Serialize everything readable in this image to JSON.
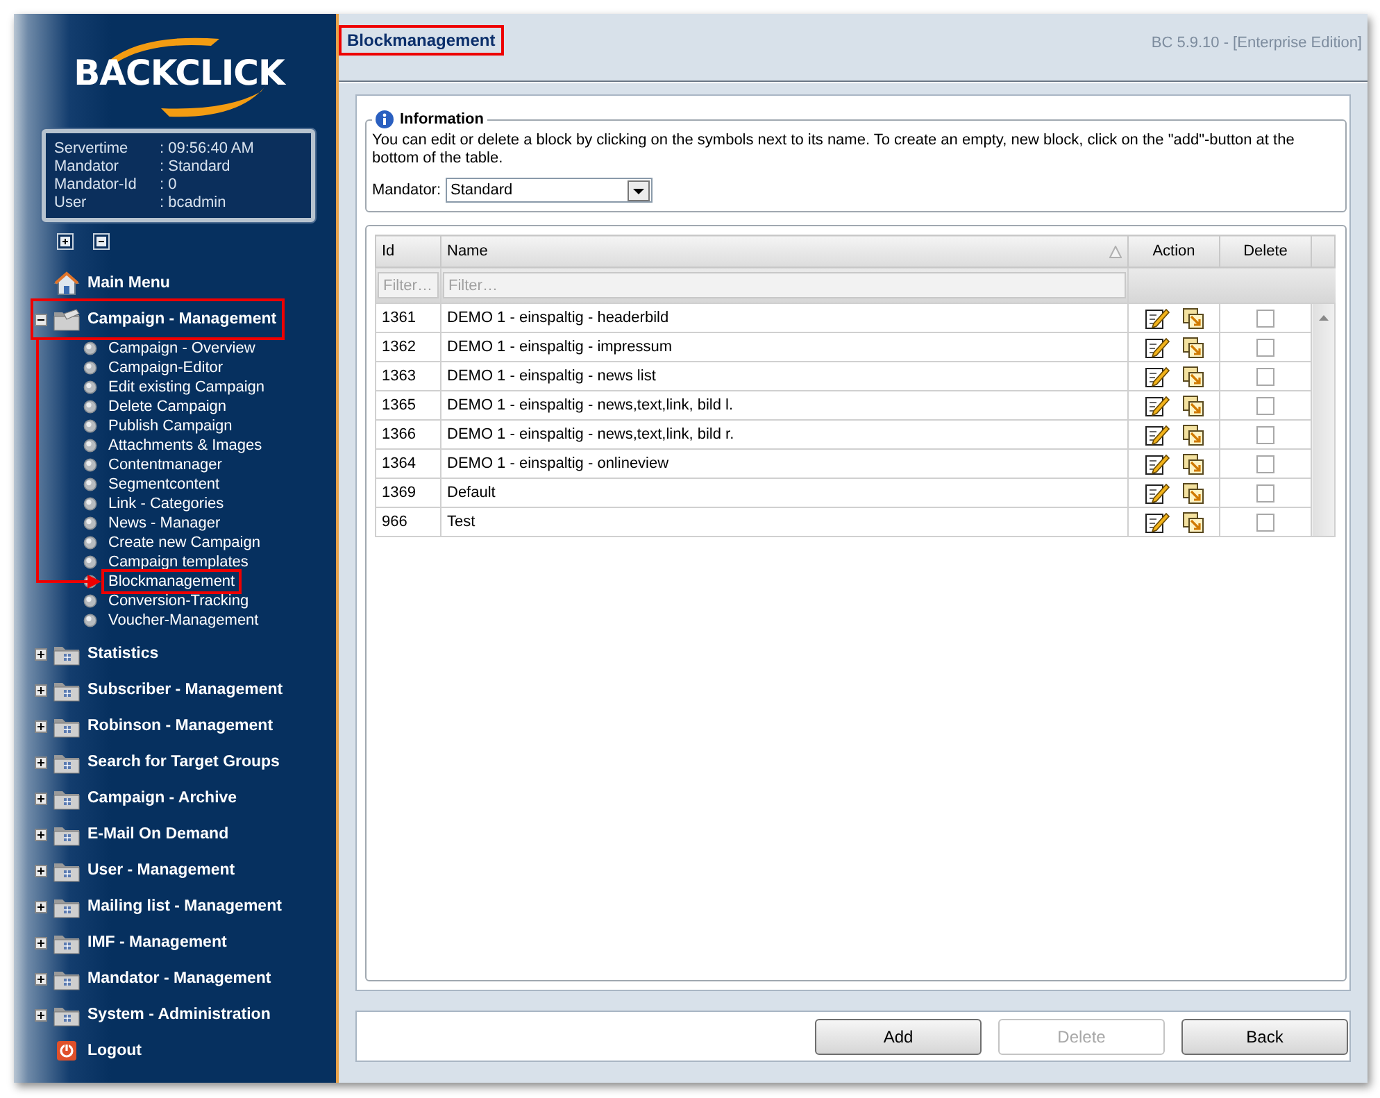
{
  "logo": {
    "text": "BACKCLICK"
  },
  "session": [
    {
      "label": "Servertime",
      "value": ": 09:56:40 AM"
    },
    {
      "label": "Mandator",
      "value": ": Standard"
    },
    {
      "label": "Mandator-Id",
      "value": ": 0"
    },
    {
      "label": "User",
      "value": ": bcadmin"
    }
  ],
  "menu": [
    {
      "kind": "home",
      "label": "Main Menu",
      "highlighted": false
    },
    {
      "kind": "folder",
      "label": "Campaign - Management",
      "expanded": true,
      "highlighted": true,
      "children": [
        {
          "label": "Campaign - Overview",
          "highlighted": false
        },
        {
          "label": "Campaign-Editor",
          "highlighted": false
        },
        {
          "label": "Edit existing Campaign",
          "highlighted": false
        },
        {
          "label": "Delete Campaign",
          "highlighted": false
        },
        {
          "label": "Publish Campaign",
          "highlighted": false
        },
        {
          "label": "Attachments & Images",
          "highlighted": false
        },
        {
          "label": "Contentmanager",
          "highlighted": false
        },
        {
          "label": "Segmentcontent",
          "highlighted": false
        },
        {
          "label": "Link - Categories",
          "highlighted": false
        },
        {
          "label": "News - Manager",
          "highlighted": false
        },
        {
          "label": "Create new Campaign",
          "highlighted": false
        },
        {
          "label": "Campaign templates",
          "highlighted": false
        },
        {
          "label": "Blockmanagement",
          "highlighted": true
        },
        {
          "label": "Conversion-Tracking",
          "highlighted": false
        },
        {
          "label": "Voucher-Management",
          "highlighted": false
        }
      ]
    },
    {
      "kind": "folder",
      "label": "Statistics",
      "expanded": false,
      "highlighted": false
    },
    {
      "kind": "folder",
      "label": "Subscriber - Management",
      "expanded": false,
      "highlighted": false
    },
    {
      "kind": "folder",
      "label": "Robinson - Management",
      "expanded": false,
      "highlighted": false
    },
    {
      "kind": "folder",
      "label": "Search for Target Groups",
      "expanded": false,
      "highlighted": false
    },
    {
      "kind": "folder",
      "label": "Campaign - Archive",
      "expanded": false,
      "highlighted": false
    },
    {
      "kind": "folder",
      "label": "E-Mail On Demand",
      "expanded": false,
      "highlighted": false
    },
    {
      "kind": "folder",
      "label": "User - Management",
      "expanded": false,
      "highlighted": false
    },
    {
      "kind": "folder",
      "label": "Mailing list - Management",
      "expanded": false,
      "highlighted": false
    },
    {
      "kind": "folder",
      "label": "IMF - Management",
      "expanded": false,
      "highlighted": false
    },
    {
      "kind": "folder",
      "label": "Mandator - Management",
      "expanded": false,
      "highlighted": false
    },
    {
      "kind": "folder",
      "label": "System - Administration",
      "expanded": false,
      "highlighted": false
    },
    {
      "kind": "logout",
      "label": "Logout",
      "highlighted": false
    }
  ],
  "header": {
    "title": "Blockmanagement",
    "highlighted": true,
    "version": "BC 5.9.10 - [Enterprise Edition]"
  },
  "information": {
    "legend": "Information",
    "text": "You can edit or delete a block by clicking on the symbols next to its name. To create an empty, new block, click on the \"add\"-button at the bottom of the table.",
    "mandator_label": "Mandator:",
    "mandator_value": "Standard"
  },
  "table": {
    "columns": [
      {
        "label": "Id",
        "sorted": false
      },
      {
        "label": "Name",
        "sorted": true
      },
      {
        "label": "Action",
        "sorted": false
      },
      {
        "label": "Delete",
        "sorted": false
      }
    ],
    "filters": [
      {
        "placeholder": "Filter…"
      },
      {
        "placeholder": "Filter…"
      }
    ],
    "rows": [
      {
        "id": "1361",
        "name": "DEMO 1 - einspaltig - headerbild",
        "checked": false
      },
      {
        "id": "1362",
        "name": "DEMO 1 - einspaltig - impressum",
        "checked": false
      },
      {
        "id": "1363",
        "name": "DEMO 1 - einspaltig - news list",
        "checked": false
      },
      {
        "id": "1365",
        "name": "DEMO 1 - einspaltig - news,text,link, bild l.",
        "checked": false
      },
      {
        "id": "1366",
        "name": "DEMO 1 - einspaltig - news,text,link, bild r.",
        "checked": false
      },
      {
        "id": "1364",
        "name": "DEMO 1 - einspaltig - onlineview",
        "checked": false
      },
      {
        "id": "1369",
        "name": "Default",
        "checked": false
      },
      {
        "id": "966",
        "name": "Test",
        "checked": false
      }
    ]
  },
  "buttons": [
    {
      "label": "Add",
      "disabled": false
    },
    {
      "label": "Delete",
      "disabled": true
    },
    {
      "label": "Back",
      "disabled": false
    }
  ]
}
